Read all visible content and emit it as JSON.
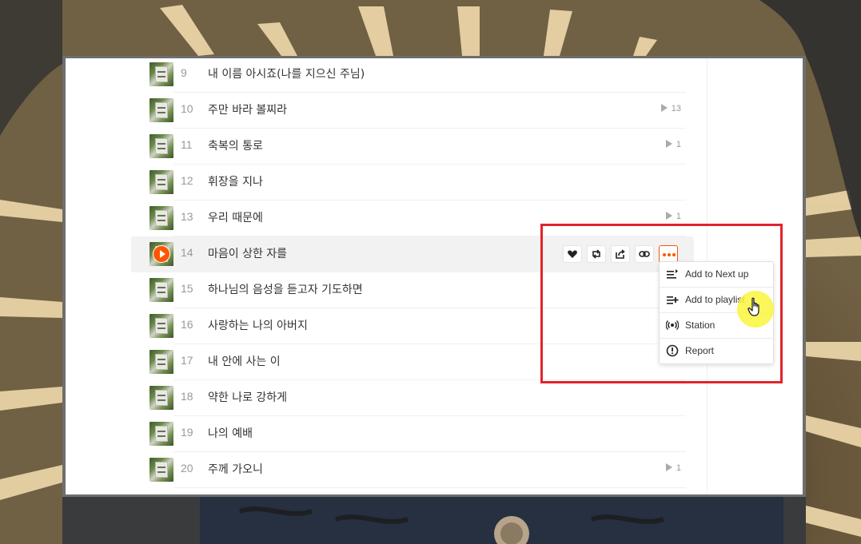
{
  "tracks": [
    {
      "num": "9",
      "title": "내 이름 아시죠(나를 지으신 주님)",
      "plays": ""
    },
    {
      "num": "10",
      "title": "주만 바라 볼찌라",
      "plays": "13"
    },
    {
      "num": "11",
      "title": "축복의 통로",
      "plays": "1"
    },
    {
      "num": "12",
      "title": "휘장을 지나",
      "plays": ""
    },
    {
      "num": "13",
      "title": "우리 때문에",
      "plays": "1"
    },
    {
      "num": "14",
      "title": "마음이 상한 자를",
      "plays": "",
      "active": true
    },
    {
      "num": "15",
      "title": "하나님의 음성을 듣고자 기도하면",
      "plays": ""
    },
    {
      "num": "16",
      "title": "사랑하는 나의 아버지",
      "plays": ""
    },
    {
      "num": "17",
      "title": "내 안에 사는 이",
      "plays": ""
    },
    {
      "num": "18",
      "title": "약한 나로 강하게",
      "plays": ""
    },
    {
      "num": "19",
      "title": "나의 예배",
      "plays": ""
    },
    {
      "num": "20",
      "title": "주께 가오니",
      "plays": "1"
    }
  ],
  "actions": [
    {
      "name": "like-button",
      "icon": "heart-icon"
    },
    {
      "name": "repost-button",
      "icon": "repost-icon"
    },
    {
      "name": "share-button",
      "icon": "share-icon"
    },
    {
      "name": "copy-link-button",
      "icon": "link-icon"
    },
    {
      "name": "more-button",
      "icon": "more-icon"
    }
  ],
  "menu": {
    "items": [
      {
        "label": "Add to Next up",
        "icon": "next-up-icon"
      },
      {
        "label": "Add to playlist",
        "icon": "add-playlist-icon"
      },
      {
        "label": "Station",
        "icon": "station-icon"
      },
      {
        "label": "Report",
        "icon": "report-icon"
      }
    ]
  },
  "colors": {
    "accent": "#ff5500",
    "highlight_border": "#e0242b",
    "cursor_halo": "#faf53c"
  }
}
